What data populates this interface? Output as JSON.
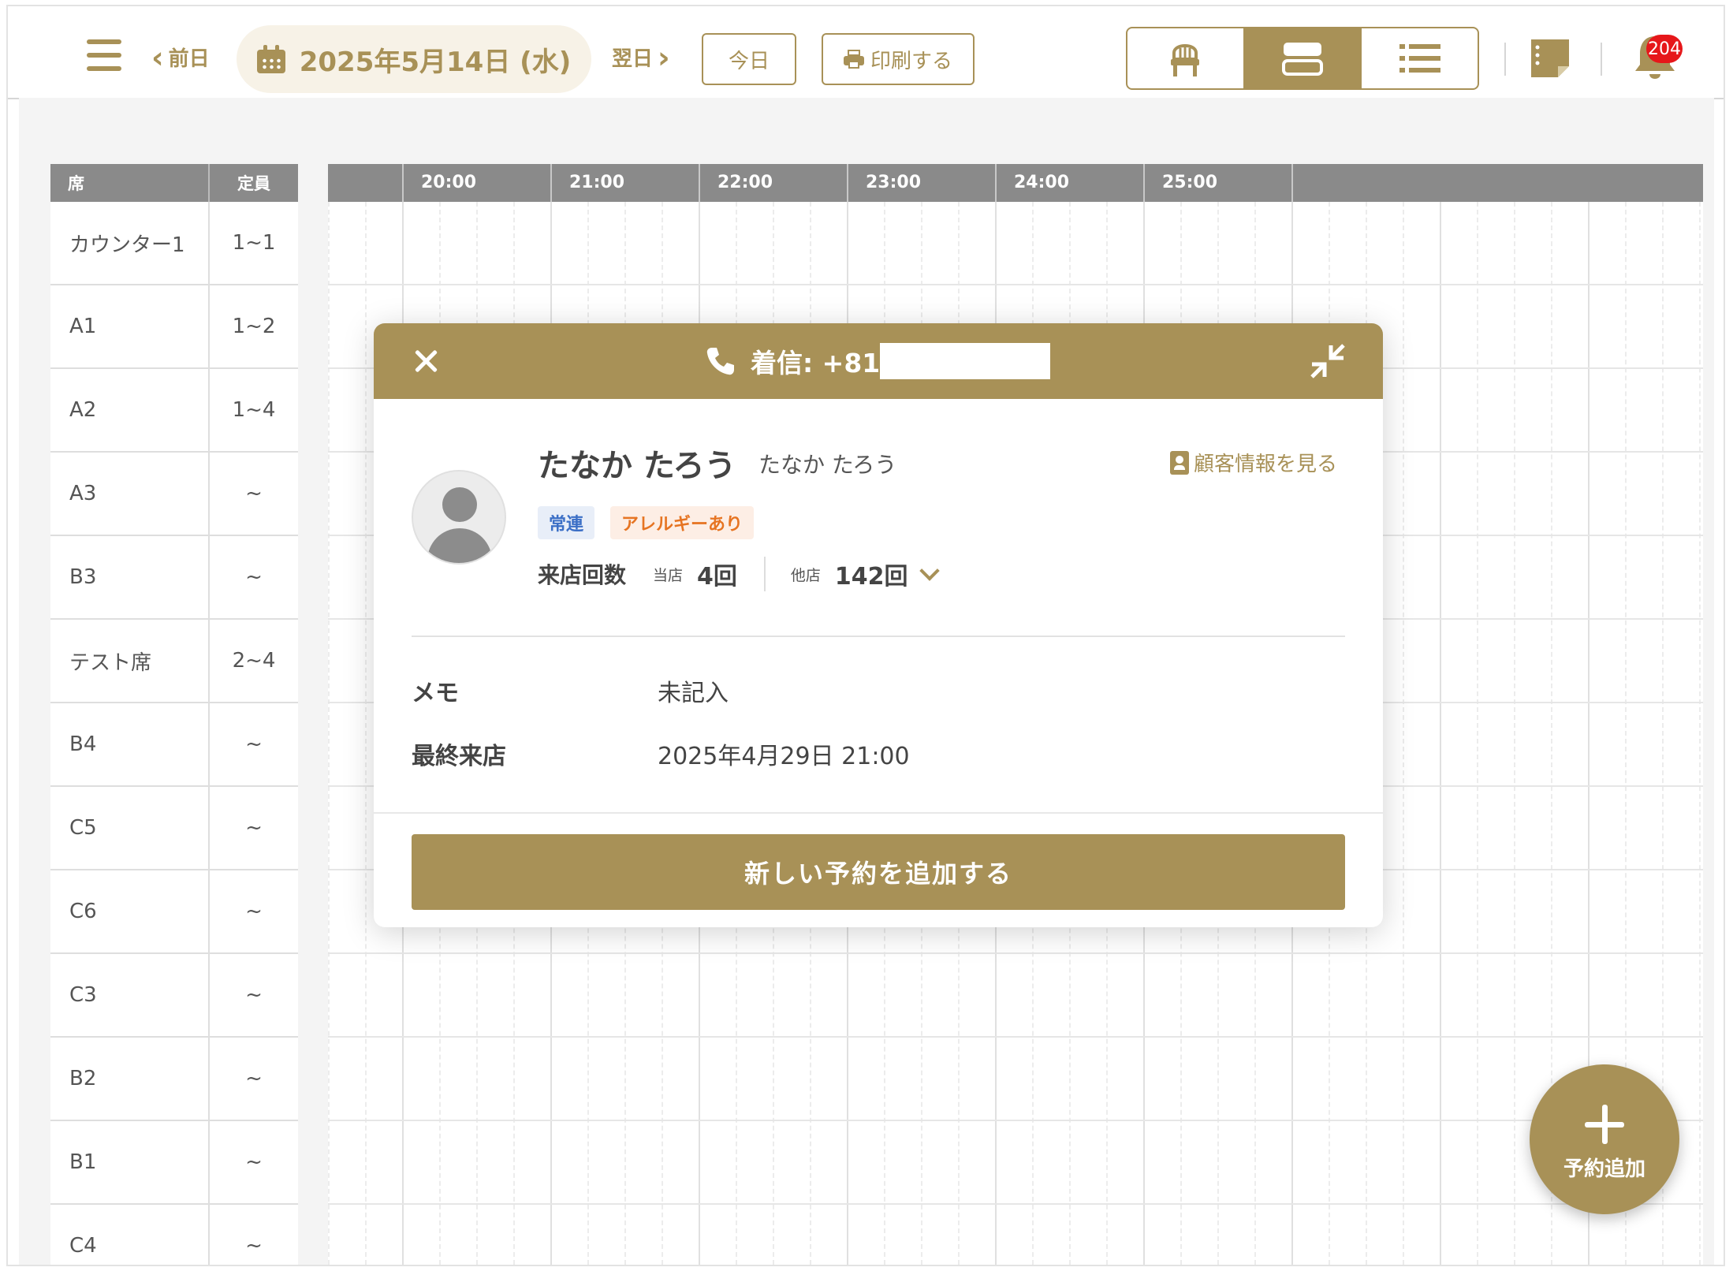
{
  "toolbar": {
    "prev_label": "前日",
    "date_label": "2025年5月14日 (水)",
    "next_label": "翌日",
    "today_label": "今日",
    "print_label": "印刷する",
    "notification_count": "204",
    "views": [
      "seat-view-icon",
      "timeline-view-icon",
      "list-view-icon"
    ],
    "active_view": "timeline-view-icon"
  },
  "seat_table": {
    "header_seat": "席",
    "header_capacity": "定員",
    "rows": [
      {
        "seat": "カウンター1",
        "capacity": "1~1"
      },
      {
        "seat": "A1",
        "capacity": "1~2"
      },
      {
        "seat": "A2",
        "capacity": "1~4"
      },
      {
        "seat": "A3",
        "capacity": "~"
      },
      {
        "seat": "B3",
        "capacity": "~"
      },
      {
        "seat": "テスト席",
        "capacity": "2~4"
      },
      {
        "seat": "B4",
        "capacity": "~"
      },
      {
        "seat": "C5",
        "capacity": "~"
      },
      {
        "seat": "C6",
        "capacity": "~"
      },
      {
        "seat": "C3",
        "capacity": "~"
      },
      {
        "seat": "B2",
        "capacity": "~"
      },
      {
        "seat": "B1",
        "capacity": "~"
      },
      {
        "seat": "C4",
        "capacity": "~"
      }
    ]
  },
  "timeline": {
    "hours": [
      "20:00",
      "21:00",
      "22:00",
      "23:00",
      "24:00",
      "25:00"
    ]
  },
  "incoming_call": {
    "title_prefix": "着信: +81",
    "customer_name": "たなか たろう",
    "customer_kana": "たなか たろう",
    "view_customer_label": "顧客情報を見る",
    "tags": {
      "regular": "常連",
      "allergy": "アレルギーあり"
    },
    "visits_label": "来店回数",
    "this_store_label": "当店",
    "this_store_count": "4回",
    "other_store_label": "他店",
    "other_store_count": "142回",
    "memo_label": "メモ",
    "memo_value": "未記入",
    "last_visit_label": "最終来店",
    "last_visit_value": "2025年4月29日 21:00",
    "add_reservation_label": "新しい予約を追加する"
  },
  "fab": {
    "label": "予約追加"
  },
  "colors": {
    "accent": "#a89157",
    "badge": "#e6171a",
    "header_gray": "#8a8a8a"
  }
}
